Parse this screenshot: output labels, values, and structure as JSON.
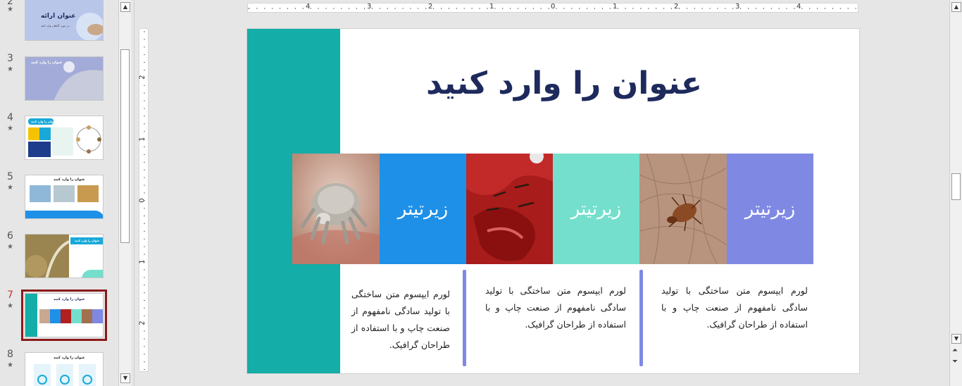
{
  "thumbnails": [
    {
      "number": "2",
      "title": "عنوان ارائه",
      "subtitle": "در مورد گیاهان وارد کنید"
    },
    {
      "number": "3",
      "title": "عنوان را وارد کنید"
    },
    {
      "number": "4",
      "title": "عنوان را وارد کنید"
    },
    {
      "number": "5",
      "title": "عنوان را وارد کنید"
    },
    {
      "number": "6",
      "title": "عنوان را وارد کنید"
    },
    {
      "number": "7",
      "title": "عنوان را وارد کنید"
    },
    {
      "number": "8",
      "title": "عنوان را وارد کنید"
    }
  ],
  "active_slide": "7",
  "ruler": {
    "horizontal": [
      "4",
      "3",
      "2",
      "1",
      "0",
      "1",
      "2",
      "3",
      "4"
    ],
    "vertical": [
      "2",
      "1",
      "0",
      "1",
      "2"
    ]
  },
  "slide": {
    "title": "عنوان را وارد کنید",
    "tiles": [
      {
        "label": "زیرتیتر",
        "color": "#1e90e8"
      },
      {
        "label": "زیرتیتر",
        "color": "#74dfcc"
      },
      {
        "label": "زیرتیتر",
        "color": "#7f89e3"
      }
    ],
    "descriptions": [
      "لورم ایپسوم متن ساختگی با تولید سادگی نامفهوم از صنعت چاپ و با استفاده از طراحان گرافیک.",
      "لورم ایپسوم متن ساختگی با تولید سادگی نامفهوم از صنعت چاپ و با استفاده از طراحان گرافیک.",
      "لورم ایپسوم متن ساختگی با تولید سادگی نامفهوم از صنعت چاپ و با استفاده از طراحان گرافیک."
    ],
    "colors": {
      "teal_bar": "#14ada8",
      "title": "#1e2a5c",
      "divider": "#7f89e3"
    }
  }
}
